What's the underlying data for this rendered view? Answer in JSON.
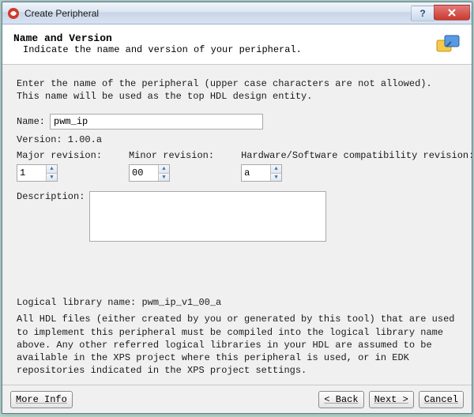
{
  "window": {
    "title": "Create Peripheral"
  },
  "header": {
    "title": "Name and Version",
    "description": "Indicate the name and version of your peripheral."
  },
  "content": {
    "intro": "Enter the name of the peripheral (upper case characters are not allowed). This name will be used as the top HDL design entity.",
    "name_label": "Name:",
    "name_value": "pwm_ip",
    "version_label": "Version: 1.00.a",
    "major_label": "Major revision:",
    "major_value": "1",
    "minor_label": "Minor revision:",
    "minor_value": "00",
    "hwsw_label": "Hardware/Software compatibility revision:",
    "hwsw_value": "a",
    "desc_label": "Description:",
    "desc_value": "",
    "lib_label": "Logical library name:",
    "lib_value": "pwm_ip_v1_00_a",
    "lib_desc": "All HDL files (either created by you or generated by this tool) that are used to implement this peripheral must be compiled into the logical library name above. Any other referred logical libraries in your HDL are assumed to be available in the XPS project where this peripheral is used, or in EDK repositories indicated in the XPS project settings."
  },
  "buttons": {
    "more_info": "More Info",
    "back": "< Back",
    "next": "Next >",
    "cancel": "Cancel"
  }
}
